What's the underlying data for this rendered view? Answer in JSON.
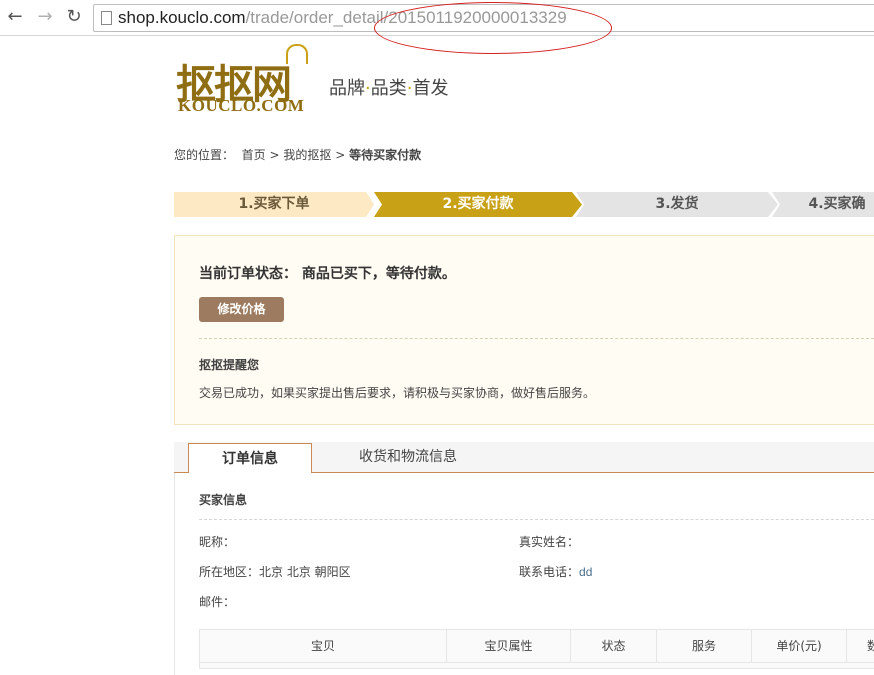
{
  "browser": {
    "url_host": "shop.kouclo.com",
    "url_path": "/trade/order_detail/20150119200000",
    "url_tail": "13329"
  },
  "header": {
    "logo_cn": "抠抠网",
    "logo_en": "KOUCLO.COM",
    "slogan_1": "品牌",
    "slogan_2": "品类",
    "slogan_3": "首发",
    "dot": "·"
  },
  "breadcrumb": {
    "label": "您的位置：",
    "home": "首页",
    "sep": ">",
    "mine": "我的抠抠",
    "current": "等待买家付款"
  },
  "steps": [
    {
      "label": "1.买家下单",
      "state": "done"
    },
    {
      "label": "2.买家付款",
      "state": "current"
    },
    {
      "label": "3.发货",
      "state": "todo"
    },
    {
      "label": "4.买家确",
      "state": "todo"
    }
  ],
  "status": {
    "text": "当前订单状态：  商品已买下，等待付款。",
    "edit_price": "修改价格",
    "remind_title": "抠抠提醒您",
    "remind_text": "交易已成功，如果买家提出售后要求，请积极与买家协商，做好售后服务。"
  },
  "tabs": [
    {
      "label": "订单信息",
      "active": true
    },
    {
      "label": "收货和物流信息",
      "active": false
    }
  ],
  "buyer": {
    "section_title": "买家信息",
    "nickname_label": "昵称：",
    "realname_label": "真实姓名：",
    "region_label": "所在地区：",
    "region_value": "北京 北京 朝阳区",
    "phone_label": "联系电话：",
    "phone_value": "dd",
    "email_label": "邮件："
  },
  "items_table": {
    "headers": [
      "宝贝",
      "宝贝属性",
      "状态",
      "服务",
      "单价(元)",
      "数"
    ]
  },
  "colors": {
    "brand_gold": "#c9a116",
    "brand_brown": "#8f6d12",
    "button_brown": "#9d7b60",
    "annotation_red": "#d42020"
  }
}
